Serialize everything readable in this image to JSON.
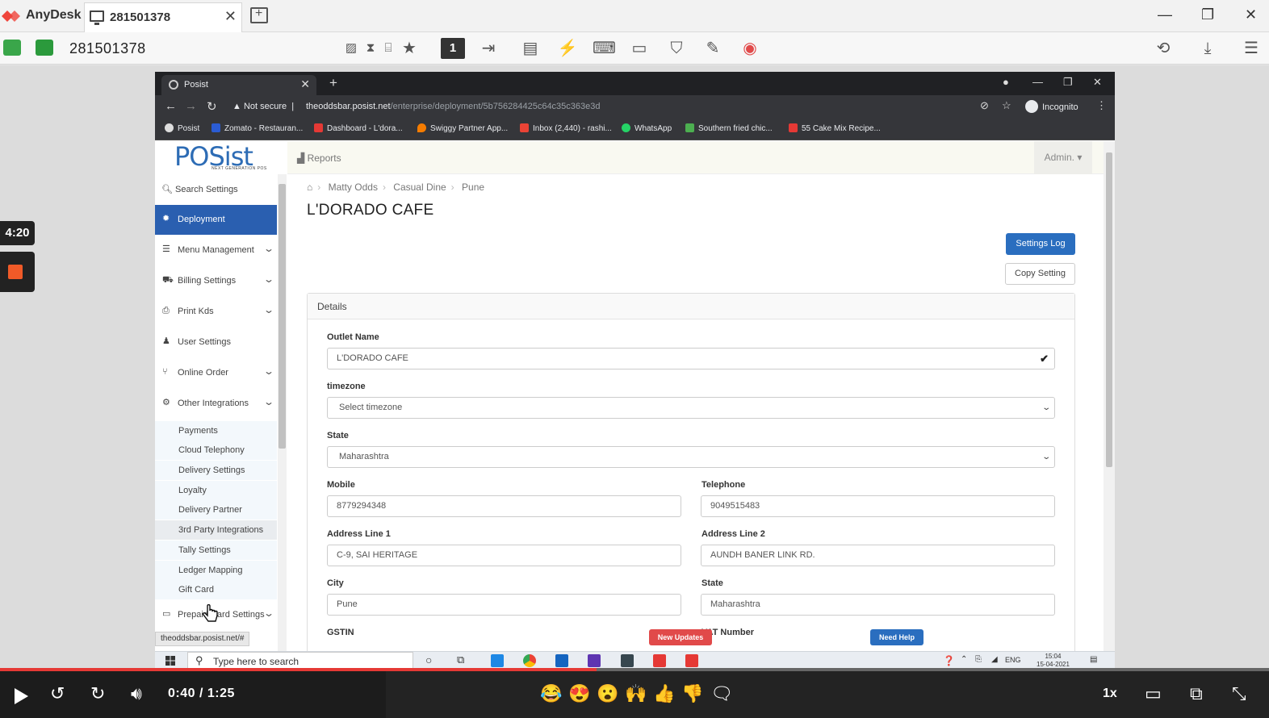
{
  "anydesk": {
    "app_name": "AnyDesk",
    "tab_label": "281501378",
    "session_id": "281501378",
    "toolbar_num": "1",
    "brand_color": "#ef443b"
  },
  "recording": {
    "timer": "4:20"
  },
  "browser": {
    "tab_title": "Posist",
    "not_secure": "Not secure",
    "url_host": "theoddsbar.posist.net",
    "url_path": "/enterprise/deployment/5b756284425c64c35c363e3d",
    "profile": "Incognito",
    "bookmarks": [
      "Posist",
      "Zomato - Restauran...",
      "Dashboard - L'dora...",
      "Swiggy Partner App...",
      "Inbox (2,440) - rashi...",
      "WhatsApp",
      "Southern fried chic...",
      "55 Cake Mix Recipe..."
    ],
    "status_url": "theoddsbar.posist.net/#"
  },
  "app": {
    "logo": "POSist",
    "logo_tagline": "NEXT GENERATION POS",
    "reports": "Reports",
    "admin": "Admin.",
    "search_settings": "Search Settings",
    "nav": {
      "deployment": "Deployment",
      "menu_management": "Menu Management",
      "billing_settings": "Billing Settings",
      "print_kds": "Print Kds",
      "user_settings": "User Settings",
      "online_order": "Online Order",
      "other_integrations": "Other Integrations",
      "prepaid_card_settings": "Prepaid Card Settings"
    },
    "sub_items": [
      "Payments",
      "Cloud Telephony",
      "Delivery Settings",
      "Loyalty",
      "Delivery Partner",
      "3rd Party Integrations",
      "Tally Settings",
      "Ledger Mapping",
      "Gift Card"
    ],
    "breadcrumb": [
      "Matty Odds",
      "Casual Dine",
      "Pune"
    ],
    "outlet_title": "L'DORADO CAFE",
    "settings_log": "Settings Log",
    "copy_setting": "Copy Setting",
    "details": "Details",
    "form": {
      "outlet_name_label": "Outlet Name",
      "outlet_name": "L'DORADO CAFE",
      "timezone_label": "timezone",
      "timezone": "Select timezone",
      "state_label": "State",
      "state": "Maharashtra",
      "mobile_label": "Mobile",
      "mobile": "8779294348",
      "telephone_label": "Telephone",
      "telephone": "9049515483",
      "address1_label": "Address Line 1",
      "address1": "C-9, SAI HERITAGE",
      "address2_label": "Address Line 2",
      "address2": "AUNDH BANER LINK RD.",
      "city_label": "City",
      "city": "Pune",
      "state2_label": "State",
      "state2": "Maharashtra",
      "gstin_label": "GSTIN",
      "vat_label": "VAT Number"
    },
    "new_updates": "New Updates",
    "need_help": "Need Help"
  },
  "taskbar": {
    "search_placeholder": "Type here to search",
    "lang": "ENG",
    "time": "15:04",
    "date": "15-04-2021"
  },
  "video": {
    "time": "0:40 / 1:25",
    "progress_fraction": 0.47,
    "speed": "1x",
    "reactions": [
      "😂",
      "😍",
      "😮",
      "🙌",
      "👍",
      "👎"
    ]
  }
}
